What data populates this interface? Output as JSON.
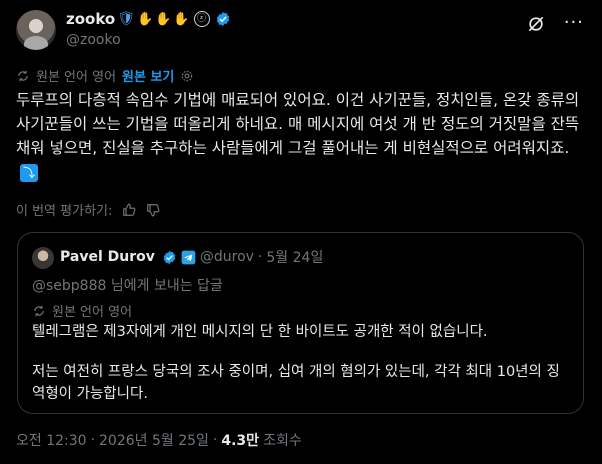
{
  "author": {
    "display_name": "zooko",
    "handle": "@zooko",
    "badges": [
      "shield-emoji",
      "raised-hand-emoji",
      "raised-hand-emoji",
      "raised-hand-emoji",
      "zcash-icon",
      "verified-badge"
    ]
  },
  "translation": {
    "label": "원본 언어 영어",
    "link": "원본 보기"
  },
  "tweet": {
    "text": "두루프의 다층적 속임수 기법에 매료되어 있어요. 이건 사기꾼들, 정치인들, 온갖 종류의 사기꾼들이 쓰는 기법을 떠올리게 하네요. 매 메시지에 여섯 개 반 정도의 거짓말을 잔뜩 채워 넣으면, 진실을 추구하는 사람들에게 그걸 풀어내는 게 비현실적으로 어려워지죠.",
    "emoji": "⤵"
  },
  "rate": {
    "label": "이 번역 평가하기:"
  },
  "quote": {
    "name": "Pavel Durov",
    "handle": "@durov",
    "separator": "·",
    "date": "5월 24일",
    "reply_to": "@sebp888 님에게 보내는 답글",
    "lang": "원본 언어 영어",
    "text1": "텔레그램은 제3자에게 개인 메시지의 단 한 바이트도 공개한 적이 없습니다.",
    "text2": "저는 여전히 프랑스 당국의 조사 중이며, 십여 개의 혐의가 있는데, 각각 최대 10년의 징역형이 가능합니다."
  },
  "footer": {
    "time": "오전 12:30",
    "separator": "·",
    "date": "2026년 5월 25일",
    "views_count": "4.3만",
    "views_label": "조회수"
  },
  "colors": {
    "background": "#000000",
    "text": "#e7e9ea",
    "muted": "#71767b",
    "accent": "#1d9bf0",
    "border": "#2f3336"
  }
}
